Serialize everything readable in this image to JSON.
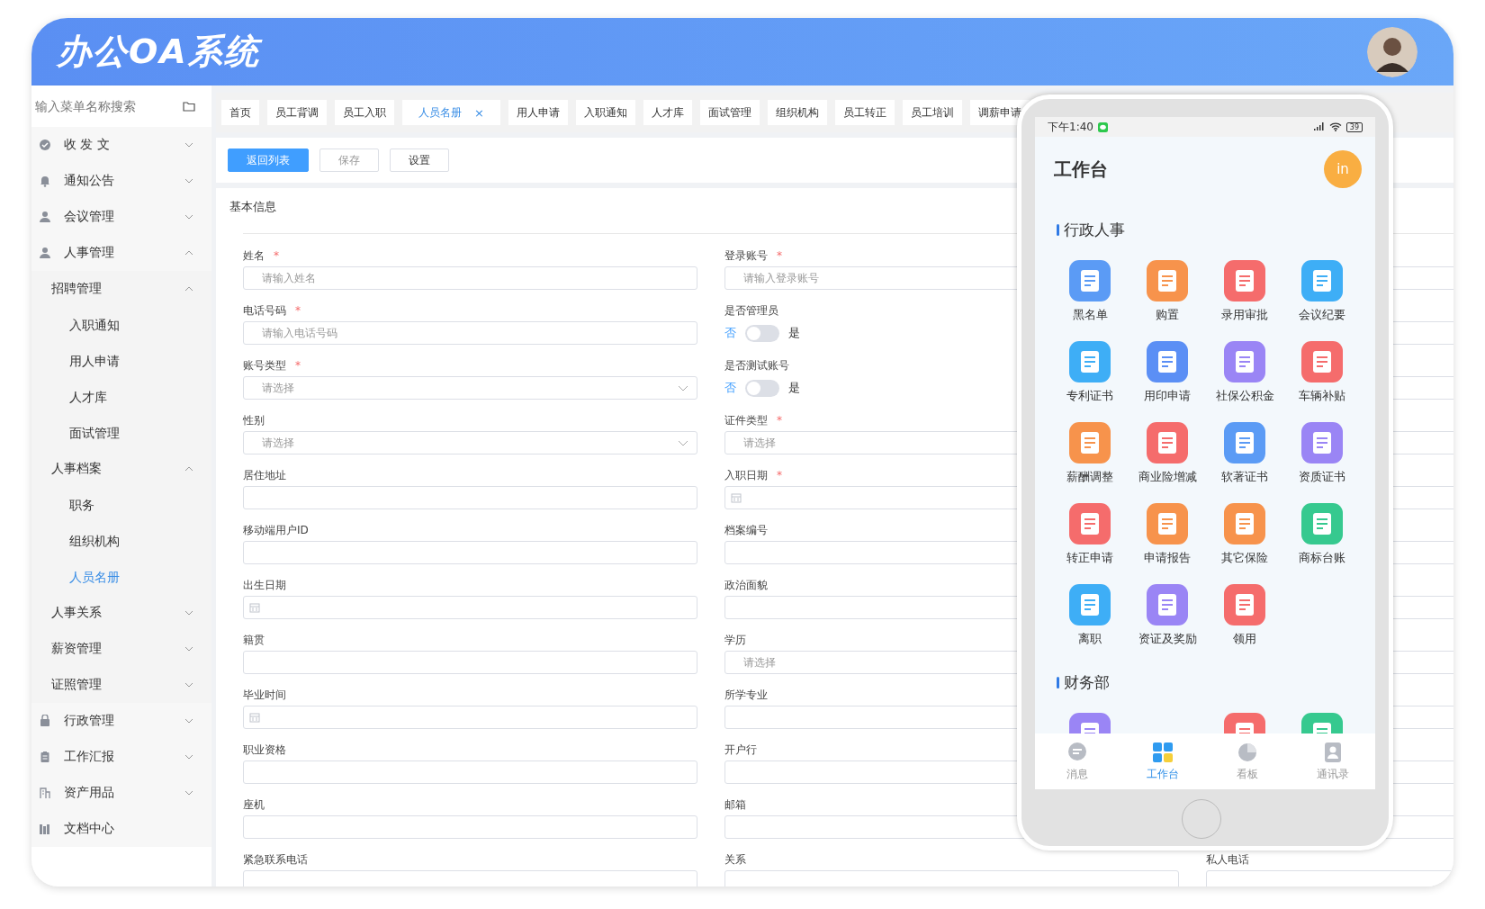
{
  "header": {
    "title": "办公OA系统"
  },
  "sidebar": {
    "search": {
      "placeholder": "输入菜单名称搜索"
    },
    "items": [
      {
        "label": "收 发 文",
        "expanded": false,
        "selected": false
      },
      {
        "label": "通知公告",
        "expanded": false,
        "selected": false
      },
      {
        "label": "会议管理",
        "expanded": false,
        "selected": false
      },
      {
        "label": "人事管理",
        "expanded": true,
        "selected": false,
        "children": [
          {
            "label": "招聘管理",
            "expanded": true,
            "selected": false,
            "children": [
              {
                "label": "入职通知",
                "selected": false
              },
              {
                "label": "用人申请",
                "selected": false
              },
              {
                "label": "人才库",
                "selected": false
              },
              {
                "label": "面试管理",
                "selected": false
              }
            ]
          },
          {
            "label": "人事档案",
            "expanded": true,
            "selected": false,
            "children": [
              {
                "label": "职务",
                "selected": false
              },
              {
                "label": "组织机构",
                "selected": false
              },
              {
                "label": "人员名册",
                "selected": true
              }
            ]
          },
          {
            "label": "人事关系",
            "expanded": false,
            "selected": false
          },
          {
            "label": "薪资管理",
            "expanded": false,
            "selected": false
          },
          {
            "label": "证照管理",
            "expanded": false,
            "selected": false
          }
        ]
      },
      {
        "label": "行政管理",
        "expanded": false,
        "selected": false
      },
      {
        "label": "工作汇报",
        "expanded": false,
        "selected": false
      },
      {
        "label": "资产用品",
        "expanded": false,
        "selected": false
      },
      {
        "label": "文档中心",
        "selected": false
      }
    ]
  },
  "tabs": [
    {
      "label": "首页",
      "selected": false
    },
    {
      "label": "员工背调",
      "selected": false
    },
    {
      "label": "员工入职",
      "selected": false
    },
    {
      "label": "人员名册",
      "selected": true,
      "close": "×"
    },
    {
      "label": "用人申请",
      "selected": false
    },
    {
      "label": "入职通知",
      "selected": false
    },
    {
      "label": "人才库",
      "selected": false
    },
    {
      "label": "面试管理",
      "selected": false
    },
    {
      "label": "组织机构",
      "selected": false
    },
    {
      "label": "员工转正",
      "selected": false
    },
    {
      "label": "员工培训",
      "selected": false
    },
    {
      "label": "调薪申请",
      "selected": false
    }
  ],
  "toolbar": [
    {
      "label": "返回列表",
      "kind": "primary"
    },
    {
      "label": "保存",
      "kind": "muted"
    },
    {
      "label": "设置",
      "kind": "plain"
    }
  ],
  "form": {
    "title": "基本信息",
    "fields": [
      {
        "label": "姓名",
        "required_mark": "*",
        "kind": "text",
        "placeholder": "请输入姓名"
      },
      {
        "label": "登录账号",
        "required_mark": "*",
        "kind": "text",
        "placeholder": "请输入登录账号"
      },
      {
        "kind": "text"
      },
      {
        "label": "电话号码",
        "required_mark": "*",
        "kind": "text",
        "placeholder": "请输入电话号码"
      },
      {
        "label": "是否管理员",
        "kind": "switch",
        "on": false,
        "off_label": "否",
        "on_label": "是"
      },
      {
        "kind": "text"
      },
      {
        "label": "账号类型",
        "required_mark": "*",
        "kind": "select",
        "placeholder": "请选择"
      },
      {
        "label": "是否测试账号",
        "kind": "switch",
        "on": false,
        "off_label": "否",
        "on_label": "是"
      },
      {
        "kind": "text"
      },
      {
        "label": "性别",
        "kind": "select",
        "placeholder": "请选择"
      },
      {
        "label": "证件类型",
        "required_mark": "*",
        "kind": "select",
        "placeholder": "请选择"
      },
      {
        "kind": "text"
      },
      {
        "label": "居住地址",
        "kind": "text"
      },
      {
        "label": "入职日期",
        "required_mark": "*",
        "kind": "date"
      },
      {
        "kind": "text"
      },
      {
        "label": "移动端用户ID",
        "kind": "text"
      },
      {
        "label": "档案编号",
        "kind": "text"
      },
      {
        "kind": "text"
      },
      {
        "label": "出生日期",
        "kind": "date"
      },
      {
        "label": "政治面貌",
        "kind": "text"
      },
      {
        "kind": "text"
      },
      {
        "label": "籍贯",
        "kind": "text"
      },
      {
        "label": "学历",
        "kind": "select",
        "placeholder": "请选择"
      },
      {
        "kind": "text"
      },
      {
        "label": "毕业时间",
        "kind": "date"
      },
      {
        "label": "所学专业",
        "kind": "text"
      },
      {
        "kind": "text"
      },
      {
        "label": "职业资格",
        "kind": "text"
      },
      {
        "label": "开户行",
        "kind": "text"
      },
      {
        "kind": "text"
      },
      {
        "label": "座机",
        "kind": "text"
      },
      {
        "label": "邮箱",
        "kind": "text"
      },
      {
        "kind": "text"
      },
      {
        "label": "紧急联系电话",
        "kind": "text"
      },
      {
        "label": "关系",
        "kind": "text"
      },
      {
        "label": "私人电话",
        "kind": "text"
      }
    ]
  },
  "phone": {
    "time": "下午1:40",
    "battery": "39",
    "title": "工作台",
    "avatar": "in",
    "sections": [
      {
        "title": "行政人事",
        "apps": [
          {
            "label": "黑名单",
            "kind": "app",
            "color": "#5b9bf5"
          },
          {
            "label": "购置",
            "kind": "app",
            "color": "#f7934c"
          },
          {
            "label": "录用审批",
            "kind": "app",
            "color": "#f56c6c"
          },
          {
            "label": "会议纪要",
            "kind": "app",
            "color": "#3eaef6"
          },
          {
            "label": "专利证书",
            "kind": "app",
            "color": "#3eaef6"
          },
          {
            "label": "用印申请",
            "kind": "app",
            "color": "#5b8ff5"
          },
          {
            "label": "社保公积金",
            "kind": "app",
            "color": "#9a85f5"
          },
          {
            "label": "车辆补贴",
            "kind": "app",
            "color": "#f56c6c"
          },
          {
            "label": "薪酬调整",
            "kind": "app",
            "color": "#f7934c"
          },
          {
            "label": "商业险增减",
            "kind": "app",
            "color": "#f56c6c"
          },
          {
            "label": "软著证书",
            "kind": "app",
            "color": "#5b9bf5"
          },
          {
            "label": "资质证书",
            "kind": "app",
            "color": "#9a85f5"
          },
          {
            "label": "转正申请",
            "kind": "app",
            "color": "#f56c6c"
          },
          {
            "label": "申请报告",
            "kind": "app",
            "color": "#f7934c"
          },
          {
            "label": "其它保险",
            "kind": "app",
            "color": "#f7934c"
          },
          {
            "label": "商标台账",
            "kind": "app",
            "color": "#36c98f"
          },
          {
            "label": "离职",
            "kind": "app",
            "color": "#3eaef6"
          },
          {
            "label": "资证及奖励",
            "kind": "app",
            "color": "#9a85f5"
          },
          {
            "label": "领用",
            "kind": "app",
            "color": "#f56c6c"
          }
        ]
      },
      {
        "title": "财务部",
        "apps": [
          {
            "kind": "app",
            "color": "#9a85f5"
          },
          {
            "kind": "blank"
          },
          {
            "kind": "app",
            "color": "#f56c6c"
          },
          {
            "kind": "app",
            "color": "#36c98f"
          }
        ]
      }
    ],
    "nav": [
      {
        "label": "消息",
        "selected": false
      },
      {
        "label": "工作台",
        "selected": true
      },
      {
        "label": "看板",
        "selected": false
      },
      {
        "label": "通讯录",
        "selected": false
      }
    ]
  }
}
